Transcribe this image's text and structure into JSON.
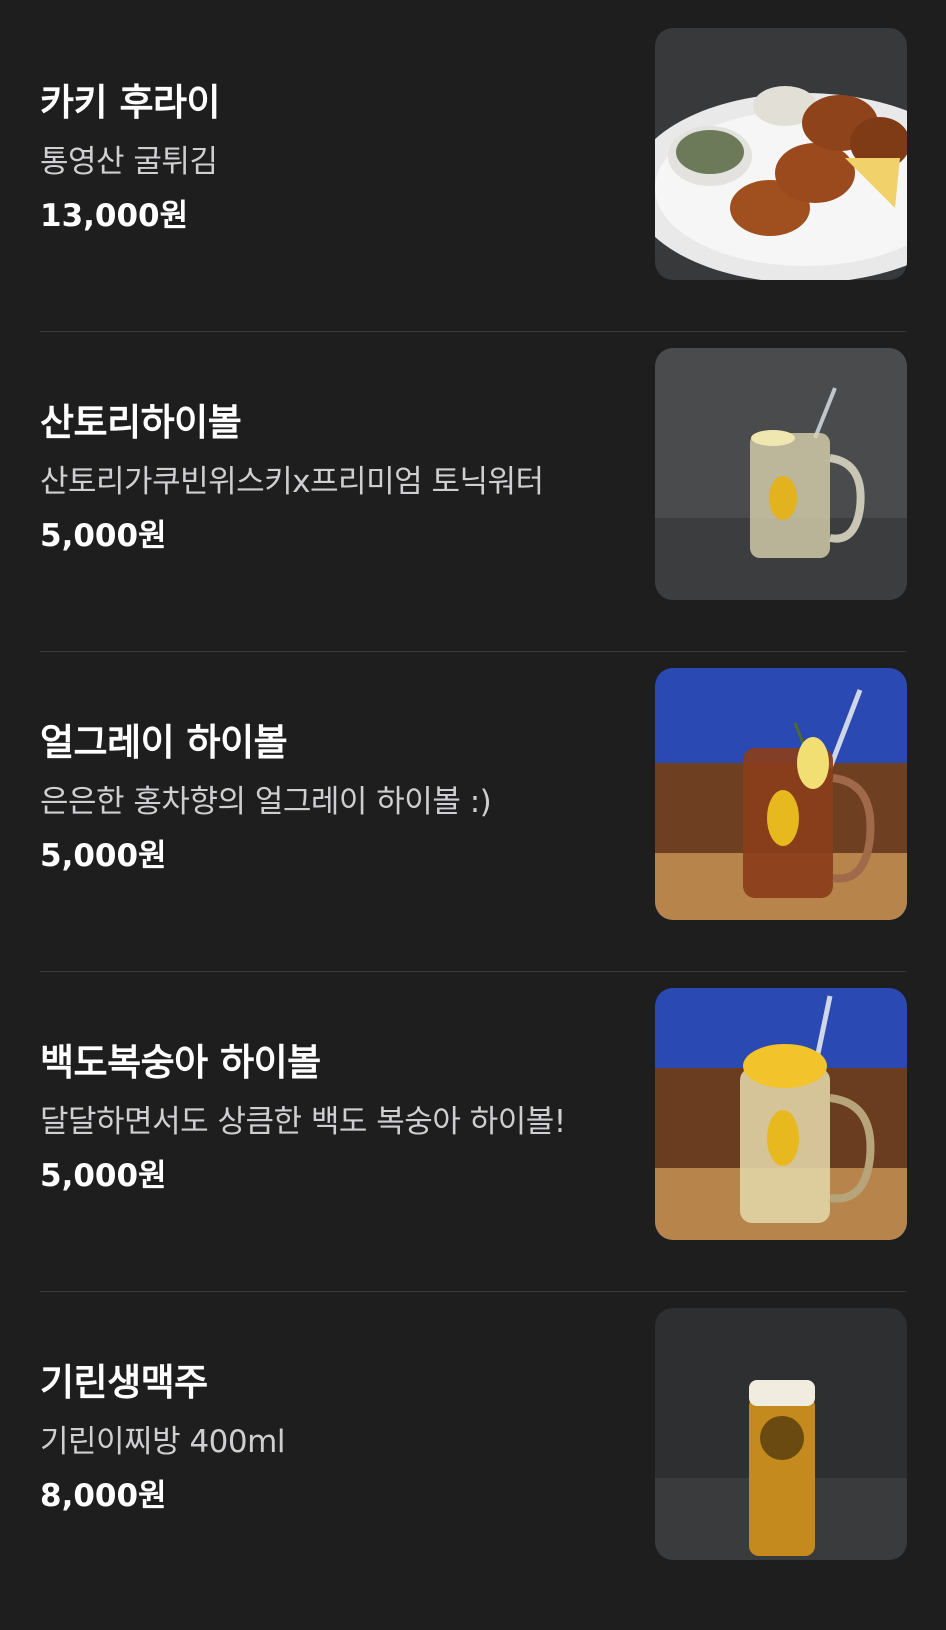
{
  "menu": [
    {
      "name": "카키 후라이",
      "description": "통영산 굴튀김",
      "price": "13,000원",
      "image": "oyster-fry-photo"
    },
    {
      "name": "산토리하이볼",
      "description": "산토리가쿠빈위스키x프리미엄 토닉워터",
      "price": "5,000원",
      "image": "highball-photo"
    },
    {
      "name": "얼그레이 하이볼",
      "description": "은은한 홍차향의 얼그레이 하이볼 :)",
      "price": "5,000원",
      "image": "earl-grey-highball-photo"
    },
    {
      "name": "백도복숭아 하이볼",
      "description": "달달하면서도 상큼한 백도 복숭아 하이볼!",
      "price": "5,000원",
      "image": "peach-highball-photo"
    },
    {
      "name": "기린생맥주",
      "description": "기린이찌방 400ml",
      "price": "8,000원",
      "image": "kirin-beer-photo"
    }
  ]
}
